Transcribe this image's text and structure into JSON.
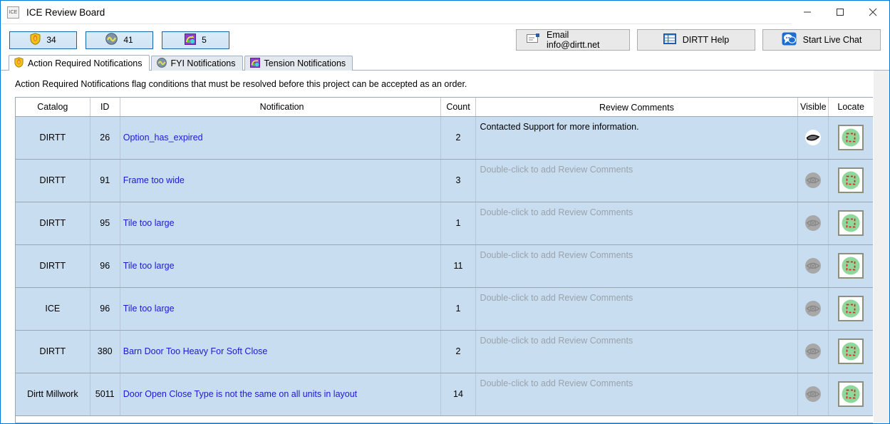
{
  "window": {
    "icon_label": "ICE",
    "title": "ICE Review Board",
    "controls": {
      "minimize": "minimize-button",
      "maximize": "maximize-button",
      "close": "close-button"
    }
  },
  "toolbar": {
    "counters": [
      {
        "icon": "shield-icon",
        "value": "34"
      },
      {
        "icon": "fyi-circle-icon",
        "value": "41"
      },
      {
        "icon": "tension-icon",
        "value": "5"
      }
    ],
    "actions": [
      {
        "icon": "envelope-icon",
        "label": "Email info@dirtt.net"
      },
      {
        "icon": "grid-icon",
        "label": "DIRTT Help"
      },
      {
        "icon": "chat-bubble-icon",
        "label": "Start Live Chat"
      }
    ]
  },
  "tabs": [
    {
      "label": "Action Required Notifications",
      "icon": "shield-icon",
      "active": true
    },
    {
      "label": "FYI Notifications",
      "icon": "fyi-circle-icon",
      "active": false
    },
    {
      "label": "Tension Notifications",
      "icon": "tension-icon",
      "active": false
    }
  ],
  "panel": {
    "description": "Action Required Notifications flag conditions that must be resolved before this project can be accepted as an order."
  },
  "table": {
    "headers": [
      "Catalog",
      "ID",
      "Notification",
      "Count",
      "Review Comments",
      "Visible",
      "Locate"
    ],
    "comment_placeholder": "Double-click to add Review Comments",
    "rows": [
      {
        "catalog": "DIRTT",
        "id": "26",
        "notification": "Option_has_expired",
        "count": "2",
        "comment": "Contacted Support for more information.",
        "has_comment": true,
        "visible_state": "on"
      },
      {
        "catalog": "DIRTT",
        "id": "91",
        "notification": "Frame too wide",
        "count": "3",
        "comment": "Double-click to add Review Comments",
        "has_comment": false,
        "visible_state": "off"
      },
      {
        "catalog": "DIRTT",
        "id": "95",
        "notification": "Tile too large",
        "count": "1",
        "comment": "Double-click to add Review Comments",
        "has_comment": false,
        "visible_state": "off"
      },
      {
        "catalog": "DIRTT",
        "id": "96",
        "notification": "Tile too large",
        "count": "11",
        "comment": "Double-click to add Review Comments",
        "has_comment": false,
        "visible_state": "off"
      },
      {
        "catalog": "ICE",
        "id": "96",
        "notification": "Tile too large",
        "count": "1",
        "comment": "Double-click to add Review Comments",
        "has_comment": false,
        "visible_state": "off"
      },
      {
        "catalog": "DIRTT",
        "id": "380",
        "notification": "Barn Door Too Heavy For Soft Close",
        "count": "2",
        "comment": "Double-click to add Review Comments",
        "has_comment": false,
        "visible_state": "off"
      },
      {
        "catalog": "Dirtt Millwork",
        "id": "5011",
        "notification": "Door Open Close Type is not the same on all units in layout",
        "count": "14",
        "comment": "Double-click to add Review Comments",
        "has_comment": false,
        "visible_state": "off"
      }
    ]
  },
  "colors": {
    "accent_border": "#0078d7",
    "row_selected": "#c9ddf0",
    "link": "#1a1ad1",
    "placeholder": "#9aa3ab",
    "locate_green": "#8fd89a",
    "locate_marker_red": "#d42626"
  }
}
